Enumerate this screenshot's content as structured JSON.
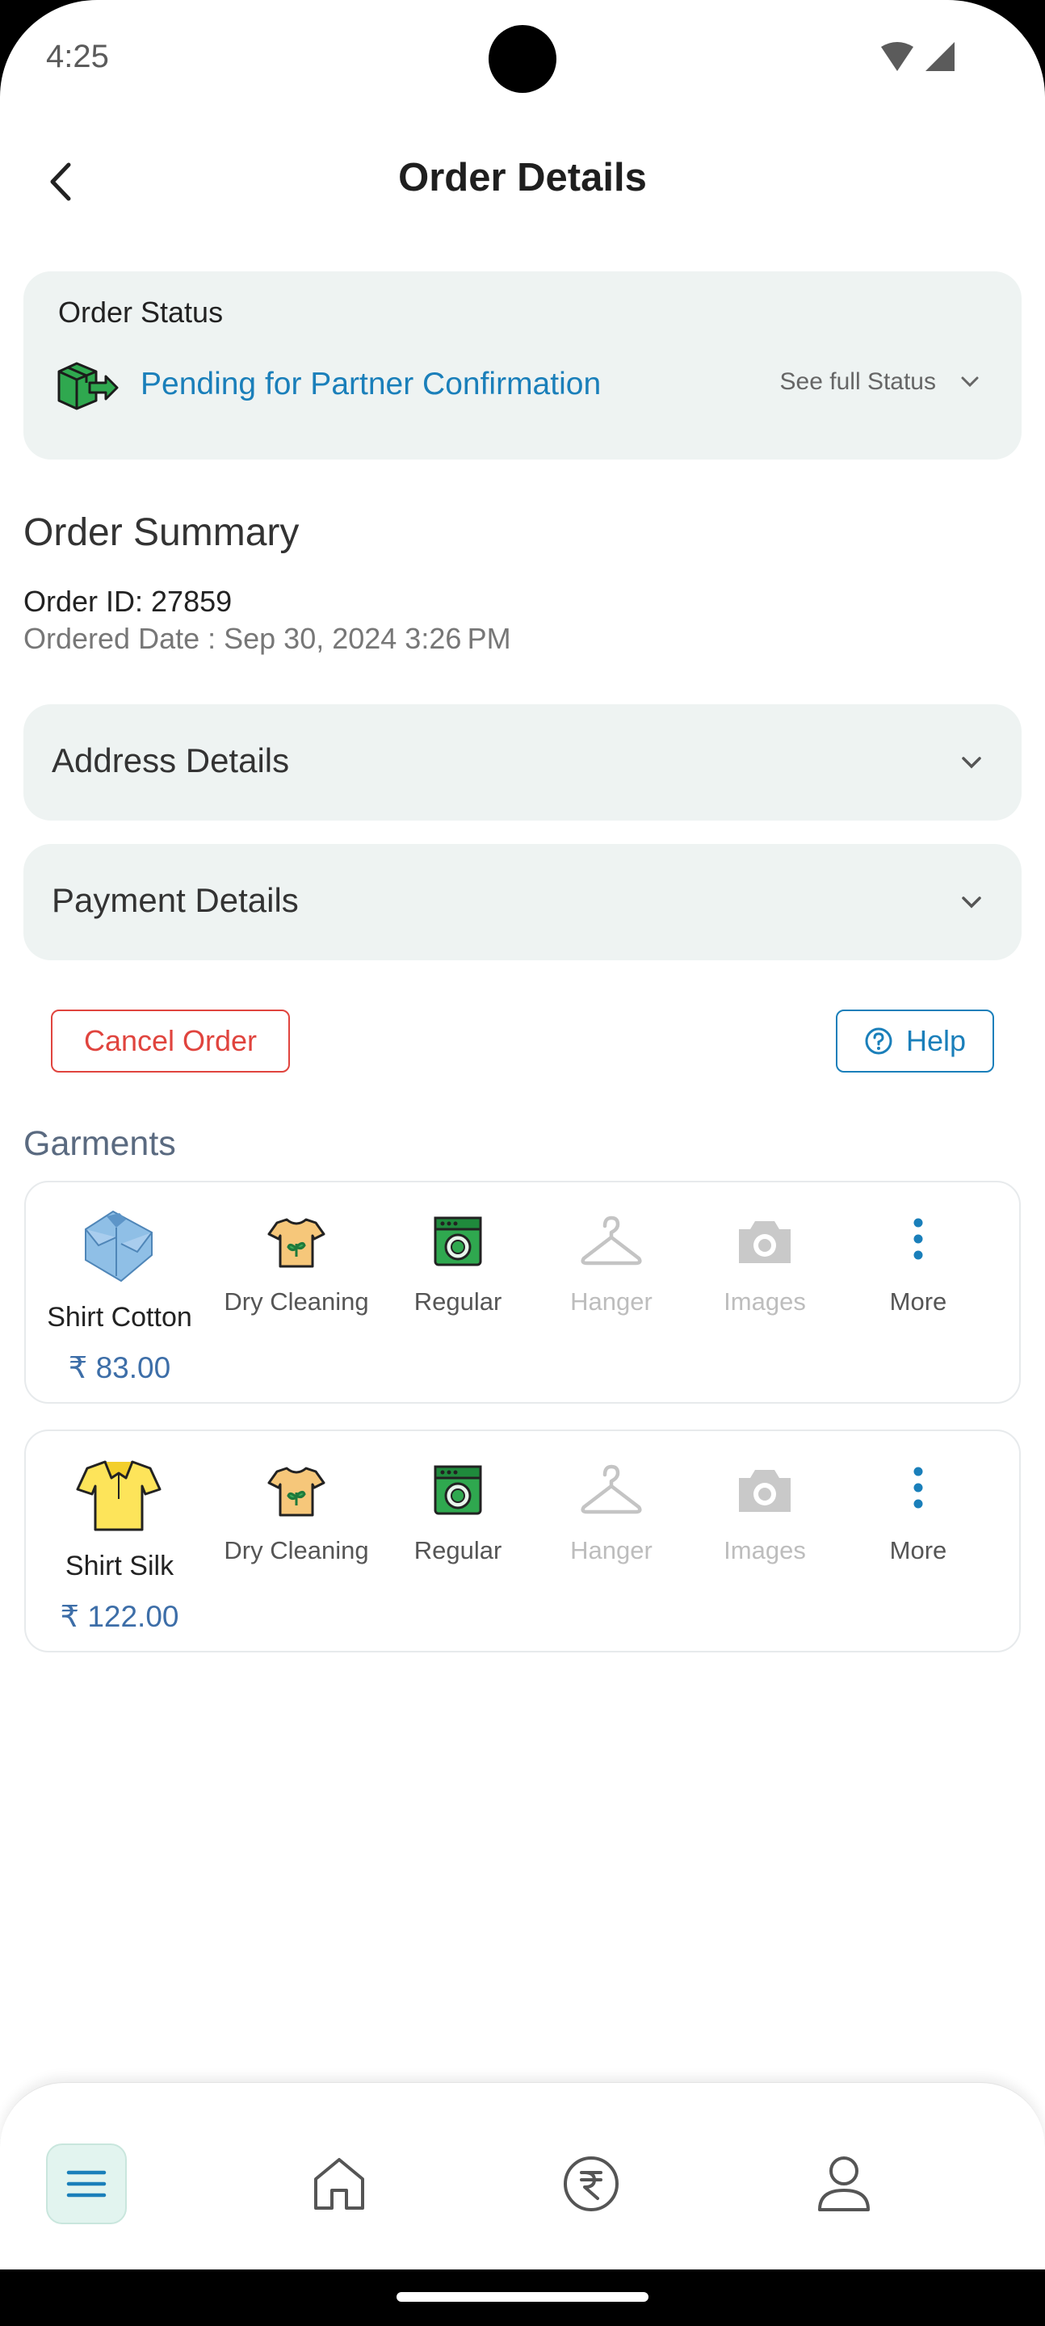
{
  "status_bar": {
    "time": "4:25"
  },
  "header": {
    "title": "Order Details"
  },
  "order_status": {
    "heading": "Order Status",
    "status": "Pending for Partner Confirmation",
    "see_full": "See full Status"
  },
  "summary": {
    "title": "Order Summary",
    "order_id": "Order ID: 27859",
    "ordered_date": "Ordered Date : Sep 30, 2024 3:26 PM"
  },
  "accordions": {
    "address": "Address Details",
    "payment": "Payment Details"
  },
  "actions": {
    "cancel": "Cancel Order",
    "help": "Help"
  },
  "garments": {
    "title": "Garments",
    "items": [
      {
        "name": "Shirt Cotton",
        "price": "₹ 83.00",
        "options": [
          {
            "label": "Dry Cleaning",
            "icon": "tshirt-plant-icon",
            "enabled": true
          },
          {
            "label": "Regular",
            "icon": "washing-machine-icon",
            "enabled": true
          },
          {
            "label": "Hanger",
            "icon": "hanger-icon",
            "enabled": false
          },
          {
            "label": "Images",
            "icon": "camera-icon",
            "enabled": false
          },
          {
            "label": "More",
            "icon": "more-vertical-icon",
            "enabled": true
          }
        ]
      },
      {
        "name": "Shirt Silk",
        "price": "₹ 122.00",
        "options": [
          {
            "label": "Dry Cleaning",
            "icon": "tshirt-plant-icon",
            "enabled": true
          },
          {
            "label": "Regular",
            "icon": "washing-machine-icon",
            "enabled": true
          },
          {
            "label": "Hanger",
            "icon": "hanger-icon",
            "enabled": false
          },
          {
            "label": "Images",
            "icon": "camera-icon",
            "enabled": false
          },
          {
            "label": "More",
            "icon": "more-vertical-icon",
            "enabled": true
          }
        ]
      }
    ]
  },
  "bottom_nav": {
    "items": [
      {
        "icon": "menu-icon",
        "active": true
      },
      {
        "icon": "home-icon",
        "active": false
      },
      {
        "icon": "rupee-icon",
        "active": false
      },
      {
        "icon": "profile-icon",
        "active": false
      }
    ]
  },
  "colors": {
    "accent": "#1a7fba",
    "danger": "#e0443e",
    "price": "#3d6ea8",
    "card_bg": "#eef3f2"
  }
}
